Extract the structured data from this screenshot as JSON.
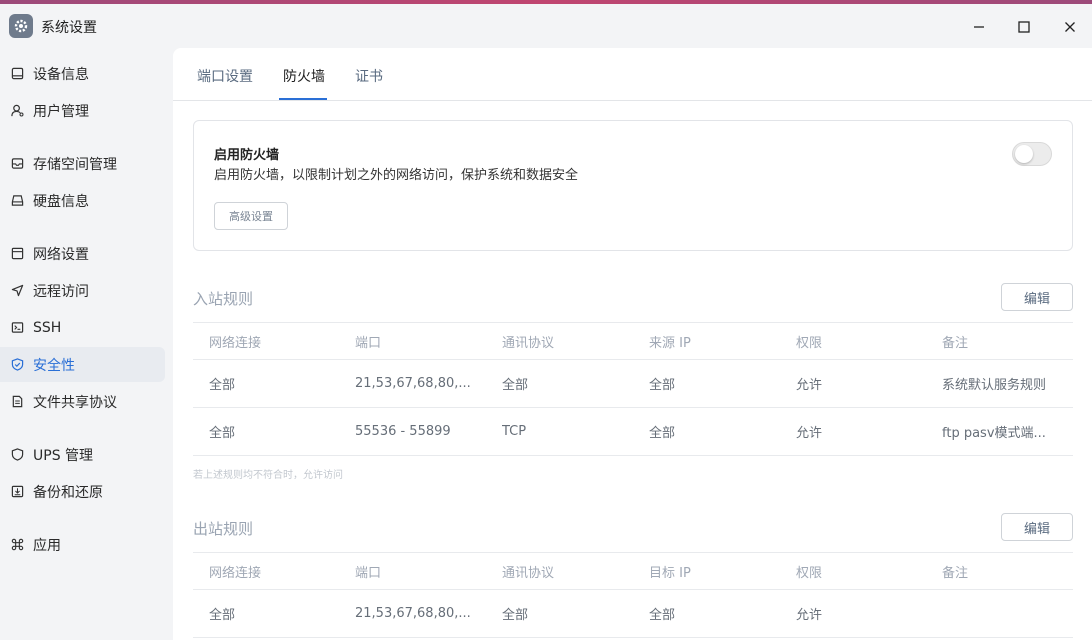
{
  "window": {
    "title": "系统设置"
  },
  "sidebar": {
    "items": [
      {
        "label": "设备信息",
        "icon": "device-icon"
      },
      {
        "label": "用户管理",
        "icon": "user-icon"
      },
      {
        "label": "存储空间管理",
        "icon": "storage-icon"
      },
      {
        "label": "硬盘信息",
        "icon": "disk-icon"
      },
      {
        "label": "网络设置",
        "icon": "network-icon"
      },
      {
        "label": "远程访问",
        "icon": "remote-icon"
      },
      {
        "label": "SSH",
        "icon": "terminal-icon"
      },
      {
        "label": "安全性",
        "icon": "shield-icon",
        "active": true
      },
      {
        "label": "文件共享协议",
        "icon": "file-icon"
      },
      {
        "label": "UPS 管理",
        "icon": "ups-icon"
      },
      {
        "label": "备份和还原",
        "icon": "backup-icon"
      },
      {
        "label": "应用",
        "icon": "apps-icon"
      }
    ]
  },
  "tabs": [
    {
      "label": "端口设置"
    },
    {
      "label": "防火墙",
      "active": true
    },
    {
      "label": "证书"
    }
  ],
  "firewall": {
    "title": "启用防火墙",
    "description": "启用防火墙，以限制计划之外的网络访问，保护系统和数据安全",
    "advanced_button": "高级设置",
    "enabled": false
  },
  "inbound": {
    "title": "入站规则",
    "edit_button": "编辑",
    "columns": [
      "网络连接",
      "端口",
      "通讯协议",
      "来源 IP",
      "权限",
      "备注"
    ],
    "rows": [
      [
        "全部",
        "21,53,67,68,80,...",
        "全部",
        "全部",
        "允许",
        "系统默认服务规则"
      ],
      [
        "全部",
        "55536 - 55899",
        "TCP",
        "全部",
        "允许",
        "ftp pasv模式端..."
      ]
    ],
    "footnote": "若上述规则均不符合时，允许访问"
  },
  "outbound": {
    "title": "出站规则",
    "edit_button": "编辑",
    "columns": [
      "网络连接",
      "端口",
      "通讯协议",
      "目标 IP",
      "权限",
      "备注"
    ],
    "rows": [
      [
        "全部",
        "21,53,67,68,80,...",
        "全部",
        "全部",
        "允许",
        ""
      ]
    ]
  },
  "colors": {
    "accent": "#2a6fd6",
    "titlebar_accent": "#c04570"
  }
}
